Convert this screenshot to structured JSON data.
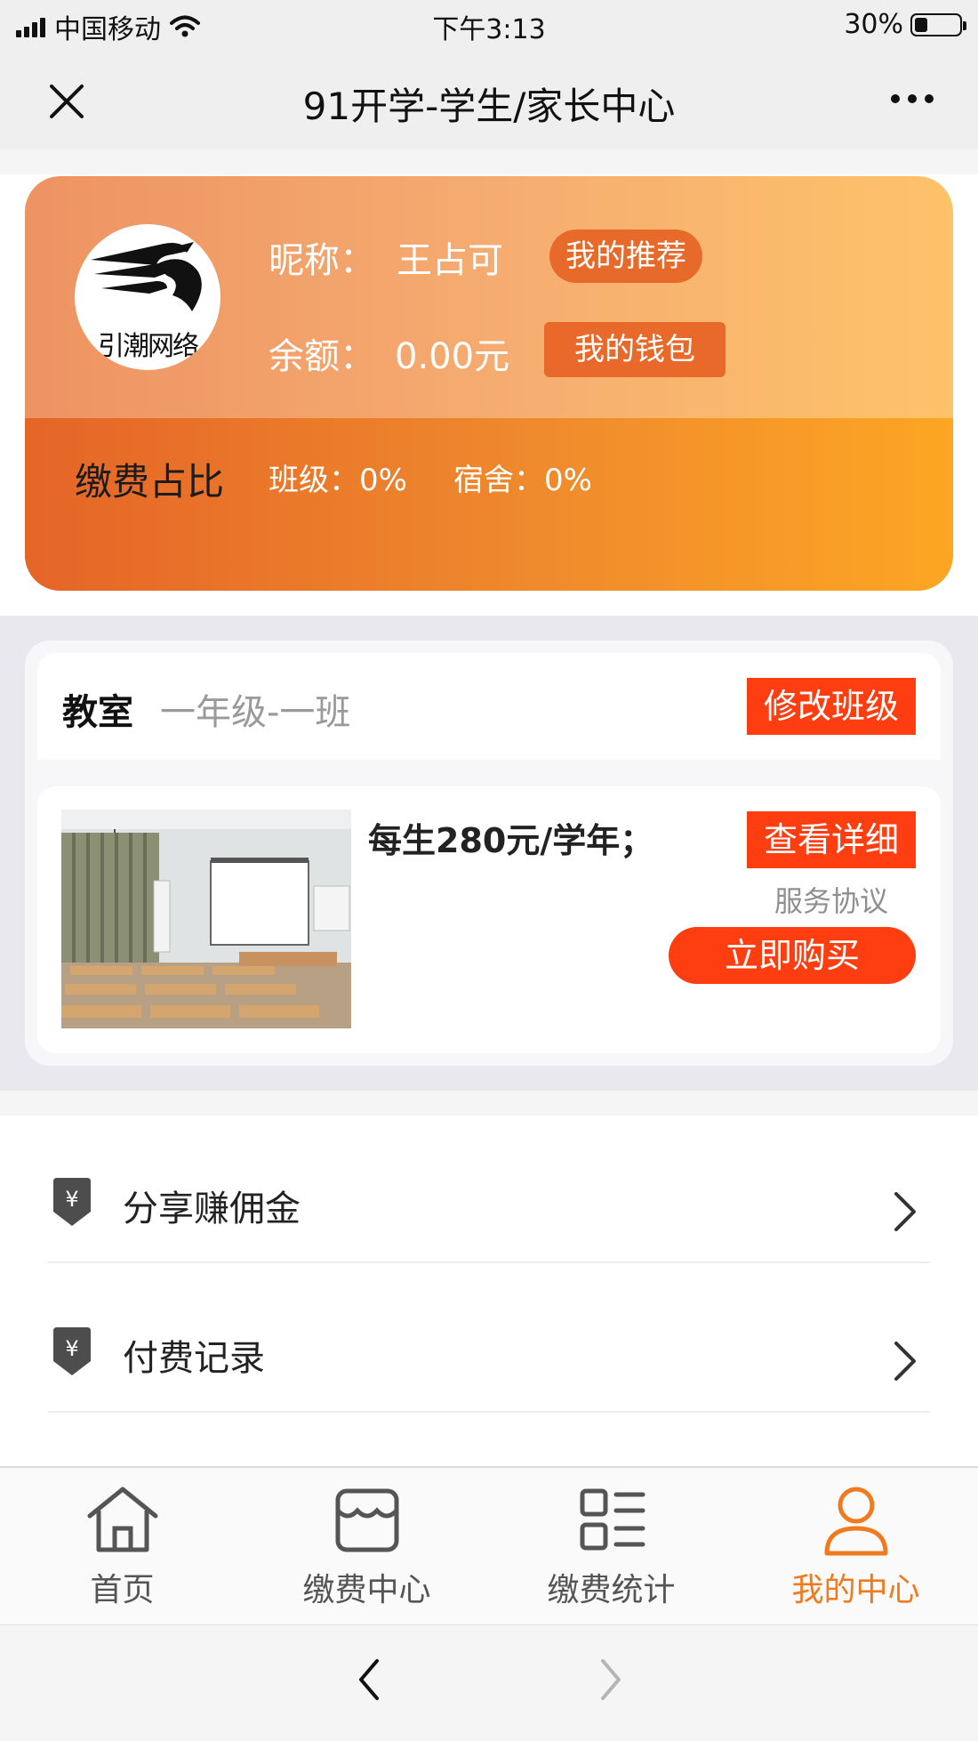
{
  "status_bar": {
    "carrier": "中国移动",
    "time": "下午3:13",
    "battery_percent": "30%",
    "battery_level": 0.3
  },
  "nav": {
    "title": "91开学-学生/家长中心"
  },
  "profile": {
    "avatar_text": "引潮网络",
    "nickname_label": "昵称：",
    "nickname": "王占可",
    "recommend_button": "我的推荐",
    "balance_label": "余额：",
    "balance": "0.00元",
    "wallet_button": "我的钱包",
    "pay_ratio_title": "缴费占比",
    "class_ratio": "班级：0%",
    "dorm_ratio": "宿舍：0%",
    "colors": {
      "top_start": "#ee9363",
      "top_end": "#fdc369",
      "bottom_start": "#e56527",
      "bottom_end": "#fda623"
    }
  },
  "classroom": {
    "label": "教室",
    "class_name": "一年级-一班",
    "edit_button": "修改班级",
    "price": "每生280元/学年；",
    "detail_button": "查看详细",
    "service_agreement": "服务协议",
    "buy_button": "立即购买",
    "accent_color": "#fe3d10"
  },
  "menu": [
    {
      "label": "分享赚佣金",
      "icon": "yen-tag-icon"
    },
    {
      "label": "付费记录",
      "icon": "yen-tag-icon"
    }
  ],
  "tabs": [
    {
      "label": "首页",
      "icon": "home-icon",
      "active": false
    },
    {
      "label": "缴费中心",
      "icon": "shop-icon",
      "active": false
    },
    {
      "label": "缴费统计",
      "icon": "list-icon",
      "active": false
    },
    {
      "label": "我的中心",
      "icon": "user-icon",
      "active": true
    }
  ],
  "active_tab_color": "#f07a1e"
}
